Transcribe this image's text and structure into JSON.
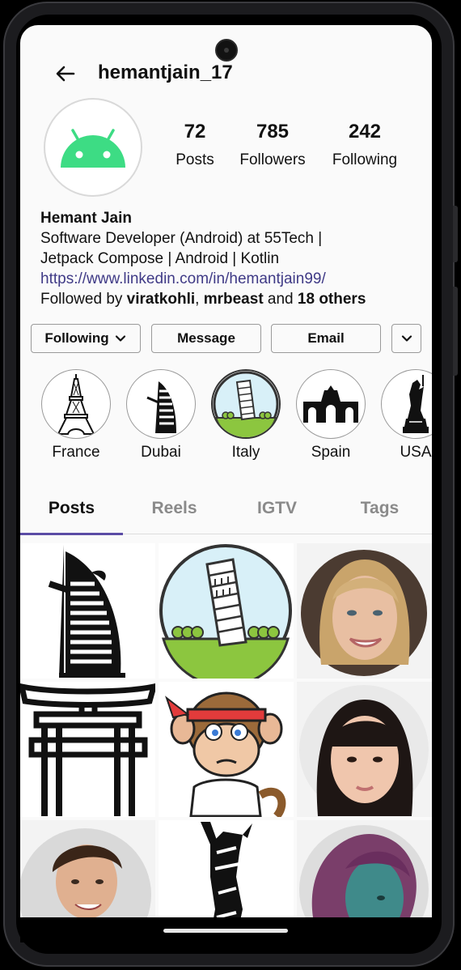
{
  "header": {
    "username": "hemantjain_17"
  },
  "stats": [
    {
      "value": "72",
      "label": "Posts"
    },
    {
      "value": "785",
      "label": "Followers"
    },
    {
      "value": "242",
      "label": "Following"
    }
  ],
  "bio": {
    "name": "Hemant Jain",
    "line1": "Software Developer (Android) at 55Tech |",
    "line2": "Jetpack Compose | Android | Kotlin",
    "link": "https://www.linkedin.com/in/hemantjain99/",
    "followed_prefix": "Followed by ",
    "followed_user1": "viratkohli",
    "followed_sep": ", ",
    "followed_user2": "mrbeast",
    "followed_and": " and ",
    "followed_others": "18 others"
  },
  "actions": {
    "following_label": "Following",
    "message_label": "Message",
    "email_label": "Email"
  },
  "highlights": [
    {
      "label": "France",
      "icon": "eiffel-tower-icon"
    },
    {
      "label": "Dubai",
      "icon": "burj-al-arab-icon"
    },
    {
      "label": "Italy",
      "icon": "leaning-tower-pisa-icon"
    },
    {
      "label": "Spain",
      "icon": "alcala-gate-icon"
    },
    {
      "label": "USA",
      "icon": "statue-of-liberty-icon"
    }
  ],
  "tabs": [
    {
      "label": "Posts",
      "active": true
    },
    {
      "label": "Reels",
      "active": false
    },
    {
      "label": "IGTV",
      "active": false
    },
    {
      "label": "Tags",
      "active": false
    }
  ],
  "colors": {
    "accent": "#5b4ca5",
    "link": "#3f3a86",
    "android_green": "#3ddc84"
  }
}
